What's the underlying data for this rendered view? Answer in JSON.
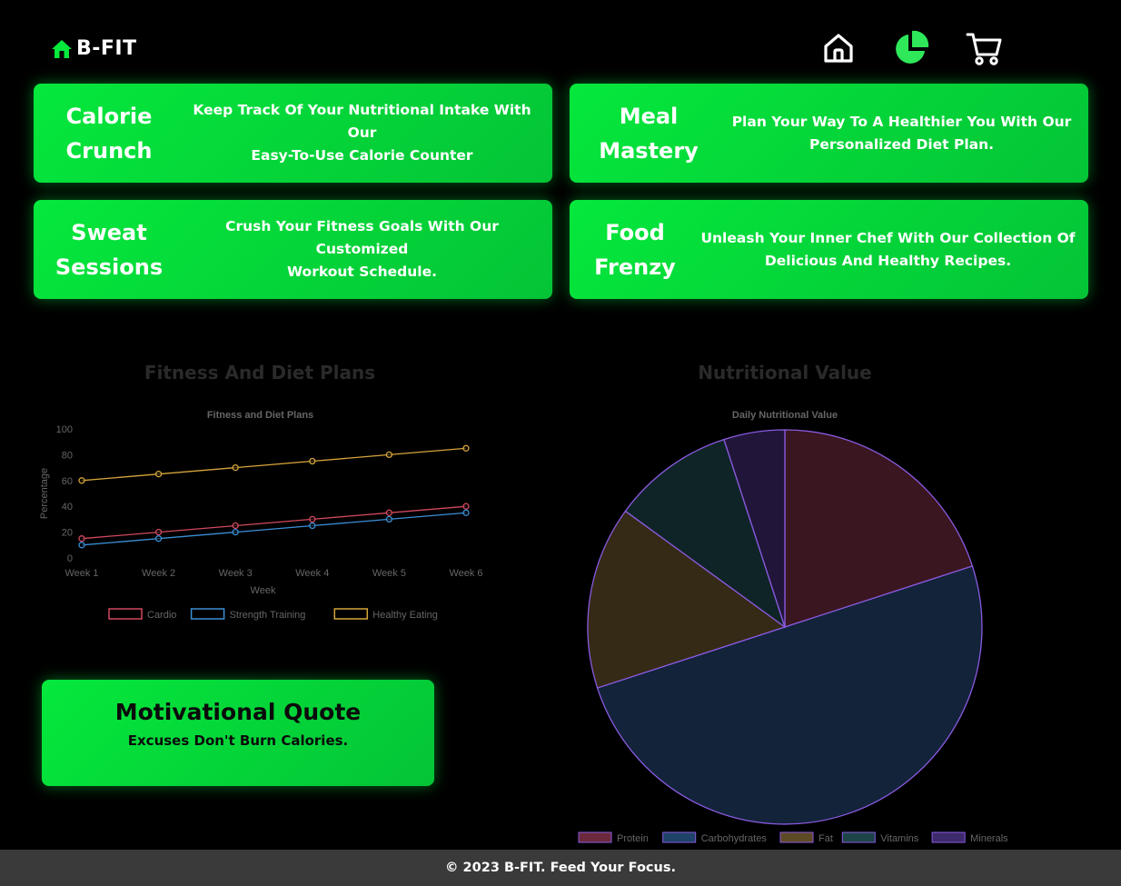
{
  "brand": {
    "name": "B-FIT",
    "icon": "home-icon",
    "color": "#05e83c"
  },
  "nav": [
    {
      "icon": "home-icon",
      "color": "#ffffff"
    },
    {
      "icon": "pie-chart-icon",
      "color": "#2ee85a"
    },
    {
      "icon": "cart-icon",
      "color": "#ffffff"
    }
  ],
  "cards": [
    {
      "title_line1": "Calorie",
      "title_line2": "Crunch",
      "desc_line1": "Keep Track Of Your Nutritional Intake With Our",
      "desc_line2": "Easy-To-Use Calorie Counter"
    },
    {
      "title_line1": "Meal",
      "title_line2": "Mastery",
      "desc_line1": "Plan Your Way To A Healthier You With Our",
      "desc_line2": "Personalized Diet Plan."
    },
    {
      "title_line1": "Sweat",
      "title_line2": "Sessions",
      "desc_line1": "Crush Your Fitness Goals With Our Customized",
      "desc_line2": "Workout Schedule."
    },
    {
      "title_line1": "Food",
      "title_line2": "Frenzy",
      "desc_line1": "Unleash Your Inner Chef With Our Collection Of",
      "desc_line2": "Delicious And Healthy Recipes."
    }
  ],
  "sections": {
    "left_heading": "Fitness And Diet Plans",
    "right_heading": "Nutritional Value"
  },
  "chart_data": [
    {
      "type": "line",
      "title": "Fitness and Diet Plans",
      "xlabel": "Week",
      "ylabel": "Percentage",
      "categories": [
        "Week 1",
        "Week 2",
        "Week 3",
        "Week 4",
        "Week 5",
        "Week 6"
      ],
      "ylim": [
        0,
        100
      ],
      "yticks": [
        0,
        20,
        40,
        60,
        80,
        100
      ],
      "legend": "bottom",
      "series": [
        {
          "name": "Cardio",
          "values": [
            15,
            20,
            25,
            30,
            35,
            40
          ],
          "color": "#d2495f"
        },
        {
          "name": "Strength Training",
          "values": [
            10,
            15,
            20,
            25,
            30,
            35
          ],
          "color": "#3b8fd6"
        },
        {
          "name": "Healthy Eating",
          "values": [
            60,
            65,
            70,
            75,
            80,
            85
          ],
          "color": "#d6a53a"
        }
      ]
    },
    {
      "type": "pie",
      "title": "Daily Nutritional Value",
      "legend": "bottom",
      "categories": [
        "Protein",
        "Carbohydrates",
        "Fat",
        "Vitamins",
        "Minerals"
      ],
      "values": [
        20,
        50,
        15,
        10,
        5
      ],
      "colors": [
        "#3a1620",
        "#12233a",
        "#352a16",
        "#0f2427",
        "#21163a"
      ],
      "legend_colors": [
        "#6a2a3c",
        "#1f4268",
        "#5e4a24",
        "#1d4548",
        "#3d2a6c"
      ],
      "border_color": "#8a5ae0"
    }
  ],
  "quote": {
    "title": "Motivational Quote",
    "text": "Excuses Don't Burn Calories."
  },
  "footer": {
    "text": "© 2023 B-FIT. Feed Your Focus."
  }
}
